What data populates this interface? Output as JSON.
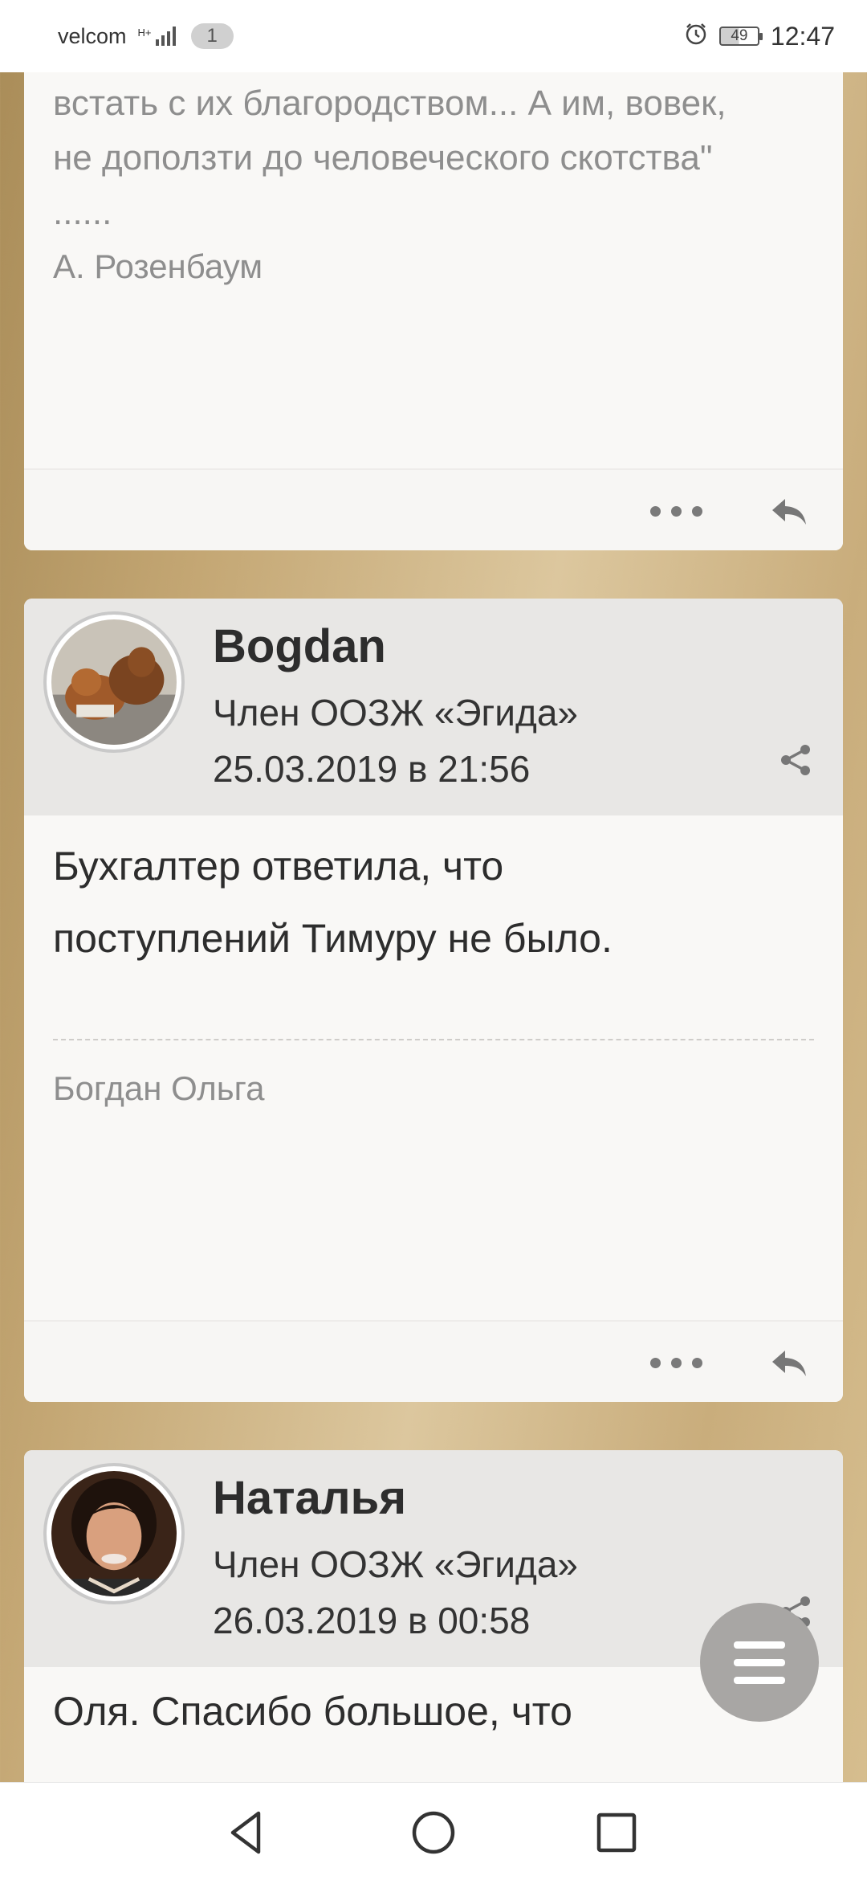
{
  "status_bar": {
    "carrier": "velcom",
    "network": "H+",
    "notification_count": "1",
    "battery": "49",
    "time": "12:47"
  },
  "post1": {
    "quote_lines": [
      "встать с их благородством... А им, вовек,",
      "не доползти до человеческого скотства\"",
      "......"
    ],
    "signature": "А. Розенбаум"
  },
  "post2": {
    "author": "Bogdan",
    "role": "Член ООЗЖ «Эгида»",
    "date": "25.03.2019 в 21:56",
    "message_lines": [
      "Бухгалтер ответила, что",
      "поступлений Тимуру не было."
    ],
    "signature": "Богдан Ольга"
  },
  "post3": {
    "author": "Наталья",
    "role": "Член ООЗЖ «Эгида»",
    "date": "26.03.2019 в 00:58",
    "message_lines": [
      "Оля. Спасибо большое, что"
    ]
  },
  "icons": {
    "more": "more-dots-icon",
    "reply": "reply-icon",
    "share": "share-icon",
    "menu": "hamburger-menu-icon",
    "nav_back": "back-triangle-icon",
    "nav_home": "home-circle-icon",
    "nav_recents": "recents-square-icon"
  },
  "colors": {
    "background_gold": "#c9ad7c",
    "card": "#f9f8f6",
    "header": "#e8e7e5",
    "fab": "#a8a6a4"
  }
}
